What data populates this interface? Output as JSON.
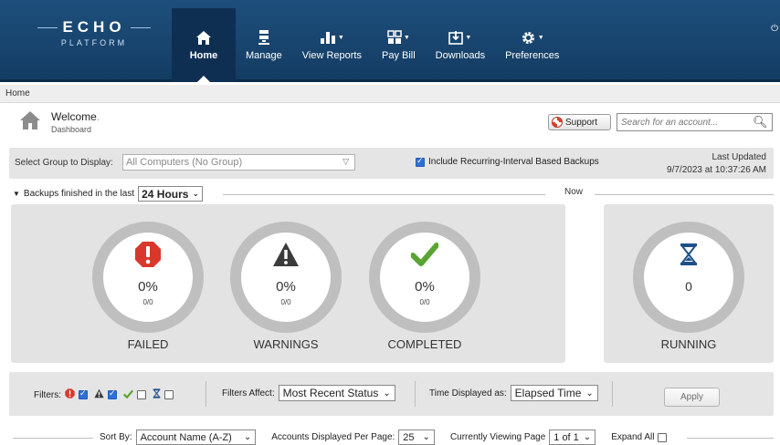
{
  "brand": {
    "name": "ECHO",
    "sub": "PLATFORM"
  },
  "nav": [
    {
      "label": "Home",
      "icon": "home-icon",
      "active": true
    },
    {
      "label": "Manage",
      "icon": "server-icon"
    },
    {
      "label": "View Reports",
      "icon": "bar-chart-icon"
    },
    {
      "label": "Pay Bill",
      "icon": "grid-icon"
    },
    {
      "label": "Downloads",
      "icon": "download-icon"
    },
    {
      "label": "Preferences",
      "icon": "gear-icon"
    }
  ],
  "breadcrumb": "Home",
  "header": {
    "title": "Welcome",
    "subtitle": "Dashboard"
  },
  "support": {
    "label": "Support"
  },
  "search": {
    "placeholder": "Search for an account..."
  },
  "group": {
    "label": "Select Group to Display:",
    "value": "All Computers (No Group)",
    "recurring_label": "Include Recurring-Interval Based Backups",
    "recurring_checked": true,
    "last_updated_label": "Last Updated",
    "last_updated_value": "9/7/2023 at 10:37:26 AM"
  },
  "range": {
    "label": "Backups finished in the last",
    "value": "24 Hours",
    "now_label": "Now"
  },
  "stats": [
    {
      "label": "FAILED",
      "percent": "0%",
      "fraction": "0/0",
      "icon": "error-octagon-icon",
      "color": "#d9372b"
    },
    {
      "label": "WARNINGS",
      "percent": "0%",
      "fraction": "0/0",
      "icon": "warning-triangle-icon",
      "color": "#3b3b3b"
    },
    {
      "label": "COMPLETED",
      "percent": "0%",
      "fraction": "0/0",
      "icon": "checkmark-icon",
      "color": "#5aa532"
    }
  ],
  "running": {
    "label": "RUNNING",
    "count": "0",
    "icon": "hourglass-icon",
    "color": "#1e4f8a"
  },
  "filters": {
    "label": "Filters:",
    "affect_label": "Filters Affect:",
    "affect_value": "Most Recent Status",
    "time_label": "Time Displayed as:",
    "time_value": "Elapsed Time",
    "apply_label": "Apply",
    "failed_checked": true,
    "warning_checked": true,
    "completed_checked": false,
    "running_checked": false
  },
  "sort": {
    "label": "Sort By:",
    "value": "Account Name (A-Z)",
    "per_page_label": "Accounts Displayed Per Page:",
    "per_page_value": "25",
    "viewing_label": "Currently Viewing Page",
    "viewing_value": "1 of 1",
    "expand_label": "Expand All"
  }
}
